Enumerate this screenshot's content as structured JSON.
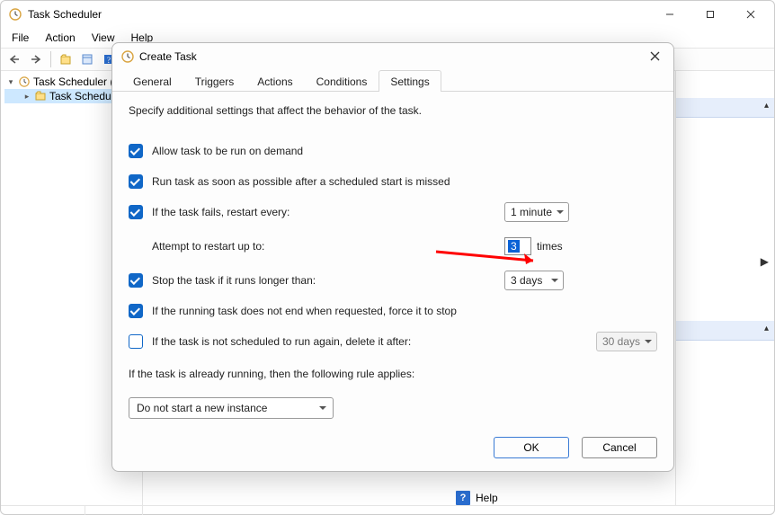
{
  "main_window": {
    "title": "Task Scheduler",
    "menus": {
      "file": "File",
      "action": "Action",
      "view": "View",
      "help": "Help"
    }
  },
  "tree": {
    "root": "Task Scheduler (L",
    "child": "Task Schedule"
  },
  "bottom": {
    "help": "Help"
  },
  "dialog": {
    "title": "Create Task",
    "tabs": {
      "general": "General",
      "triggers": "Triggers",
      "actions": "Actions",
      "conditions": "Conditions",
      "settings": "Settings"
    },
    "intro": "Specify additional settings that affect the behavior of the task.",
    "rows": {
      "allow_on_demand": "Allow task to be run on demand",
      "run_asap": "Run task as soon as possible after a scheduled start is missed",
      "restart_every": "If the task fails, restart every:",
      "restart_interval_value": "1 minute",
      "attempt_label": "Attempt to restart up to:",
      "attempt_value": "3",
      "attempt_suffix": "times",
      "stop_longer": "Stop the task if it runs longer than:",
      "stop_longer_value": "3 days",
      "force_stop": "If the running task does not end when requested, force it to stop",
      "delete_after": "If the task is not scheduled to run again, delete it after:",
      "delete_after_value": "30 days",
      "already_running": "If the task is already running, then the following rule applies:",
      "instance_rule": "Do not start a new instance"
    },
    "buttons": {
      "ok": "OK",
      "cancel": "Cancel"
    }
  }
}
